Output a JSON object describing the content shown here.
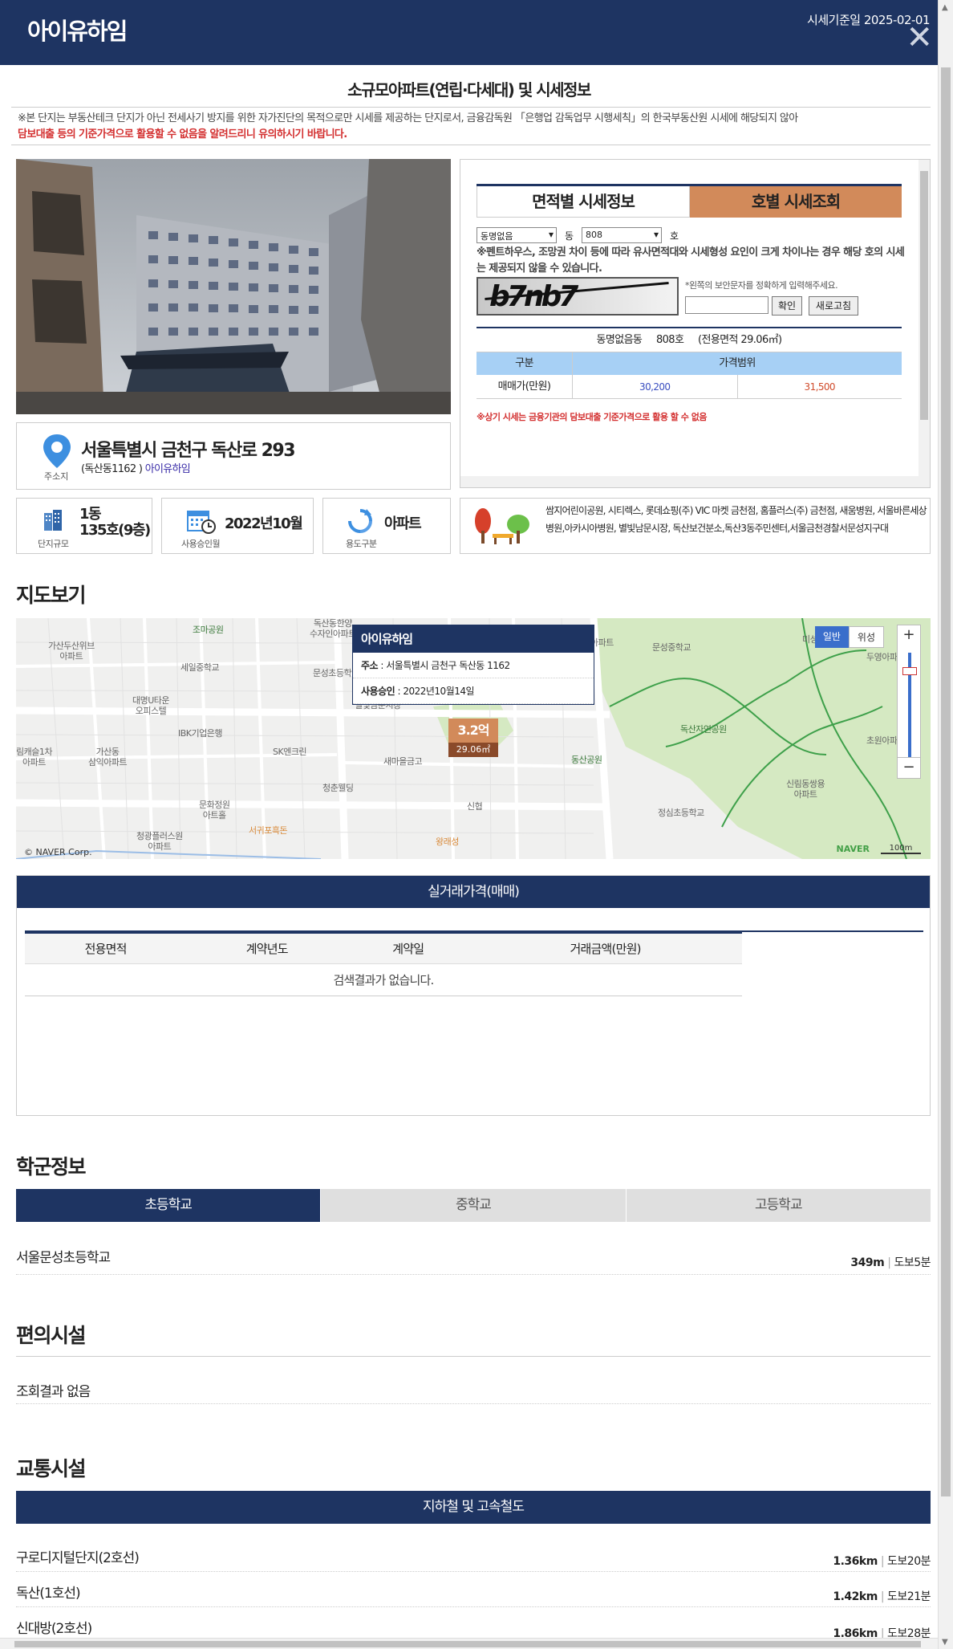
{
  "header": {
    "brand": "아이유하임",
    "date": "시세기준일 2025-02-01",
    "close": "✕"
  },
  "subtitle": "소규모아파트(연립·다세대) 및 시세정보",
  "notice": {
    "line1": "※본 단지는 부동산테크 단지가 아닌 전세사기 방지를 위한 자가진단의 목적으로만 시세를 제공하는 단지로서, 금융감독원 「은행업 감독업무 시행세칙」의 한국부동산원 시세에 해당되지 않아",
    "line2": "담보대출 등의 기준가격으로 활용할 수 없음을 알려드리니 유의하시기 바랍니다."
  },
  "address": {
    "label": "주소지",
    "main": "서울특별시 금천구 독산로 293",
    "sub_prefix": "(독산동1162 )",
    "sub_link": "아이유하임"
  },
  "price": {
    "tab_area": "면적별 시세정보",
    "tab_unit": "호별 시세조회",
    "dong_select": "동명없음",
    "dong_suffix": "동",
    "ho_select": "808",
    "ho_suffix": "호",
    "warning": "※펜트하우스, 조망권 차이 등에 따라 유사면적대와 시세형성 요인이 크게 차이나는 경우 해당 호의 시세는 제공되지 않을 수 있습니다.",
    "captcha_text": "b7nb7",
    "captcha_note": "*왼쪽의 보안문자를 정확하게 입력해주세요.",
    "btn_confirm": "확인",
    "btn_refresh": "새로고침",
    "result_title": "동명없음동     808호     (전용면적 29.06㎡)",
    "col_type": "구분",
    "col_range": "가격범위",
    "row_label": "매매가(만원)",
    "low": "30,200",
    "high": "31,500",
    "footnote": "※상기 시세는 금융기관의 담보대출 기준가격으로 활용 할 수 없음"
  },
  "info": {
    "scale_value1": "1동",
    "scale_value2": "135호(9층)",
    "scale_label": "단지규모",
    "approval_value": "2022년10월",
    "approval_label": "사용승인월",
    "usage_value": "아파트",
    "usage_label": "용도구분",
    "nearby_text": "쌈지어린이공원, 시티렉스, 롯데쇼핑(주) VIC 마켓 금천점, 홈플러스(주) 금천점, 새움병원, 서울바른세상병원,아카시아병원, 별빛남문시장, 독산보건분소,독산3동주민센터,서울금천경찰서문성지구대"
  },
  "map": {
    "section_title": "지도보기",
    "popup_title": "아이유하임",
    "popup_addr_label": "주소",
    "popup_addr": " : 서울특별시 금천구 독산동 1162",
    "popup_date_label": "사용승인",
    "popup_date": " : 2022년10월14일",
    "marker_price": "3.2억",
    "marker_area": "29.06㎡",
    "type_normal": "일반",
    "type_sat": "위성",
    "zoom_in": "+",
    "zoom_out": "−",
    "copyright": "© NAVER Corp.",
    "naver": "NAVER",
    "scale": "100m",
    "labels": {
      "l1": "가산두산위브\n아파트",
      "l2": "조마공원",
      "l3": "세일중학교",
      "l4": "대명U타운\n오피스텔",
      "l5": "IBK기업은행",
      "l6": "가산동\n삼익아파트",
      "l7": "림캐슬1차\n아파트",
      "l8": "SK엔크린",
      "l9": "새마을금고",
      "l10": "청춘웰딩",
      "l11": "문화정원\n아트홀",
      "l12": "서귀포흑돈",
      "l13": "청광플러스원\n아파트",
      "l14": "신협",
      "l15": "왕래성",
      "l16": "독산동한양\n수자인아파트",
      "l17": "문성초등학",
      "l18": "별빛남문시장",
      "l19": "문성중학교",
      "l20": "독산자연공원",
      "l21": "동산공원",
      "l22": "정심초등학교",
      "l23": "신림동쌍용\n아파트",
      "l24": "초원아파",
      "l25": "두영아파",
      "l26": "미성",
      "l27": "아파트"
    }
  },
  "deal": {
    "title": "실거래가격(매매)",
    "headers": [
      "전용면적",
      "계약년도",
      "계약일",
      "거래금액(만원)"
    ],
    "empty": "검색결과가 없습니다."
  },
  "school": {
    "title": "학군정보",
    "tabs": [
      "초등학교",
      "중학교",
      "고등학교"
    ],
    "items": [
      {
        "name": "서울문성초등학교",
        "dist": "349m",
        "walk": "도보5분"
      }
    ]
  },
  "convenience": {
    "title": "편의시설",
    "empty": "조회결과 없음"
  },
  "transport": {
    "title": "교통시설",
    "bar": "지하철 및 고속철도",
    "items": [
      {
        "name": "구로디지털단지(2호선)",
        "dist": "1.36km",
        "walk": "도보20분"
      },
      {
        "name": "독산(1호선)",
        "dist": "1.42km",
        "walk": "도보21분"
      },
      {
        "name": "신대방(2호선)",
        "dist": "1.86km",
        "walk": "도보28분"
      }
    ]
  },
  "colors": {
    "navy": "#1e3462",
    "orange": "#d28a5a",
    "red": "#d32f2f"
  }
}
